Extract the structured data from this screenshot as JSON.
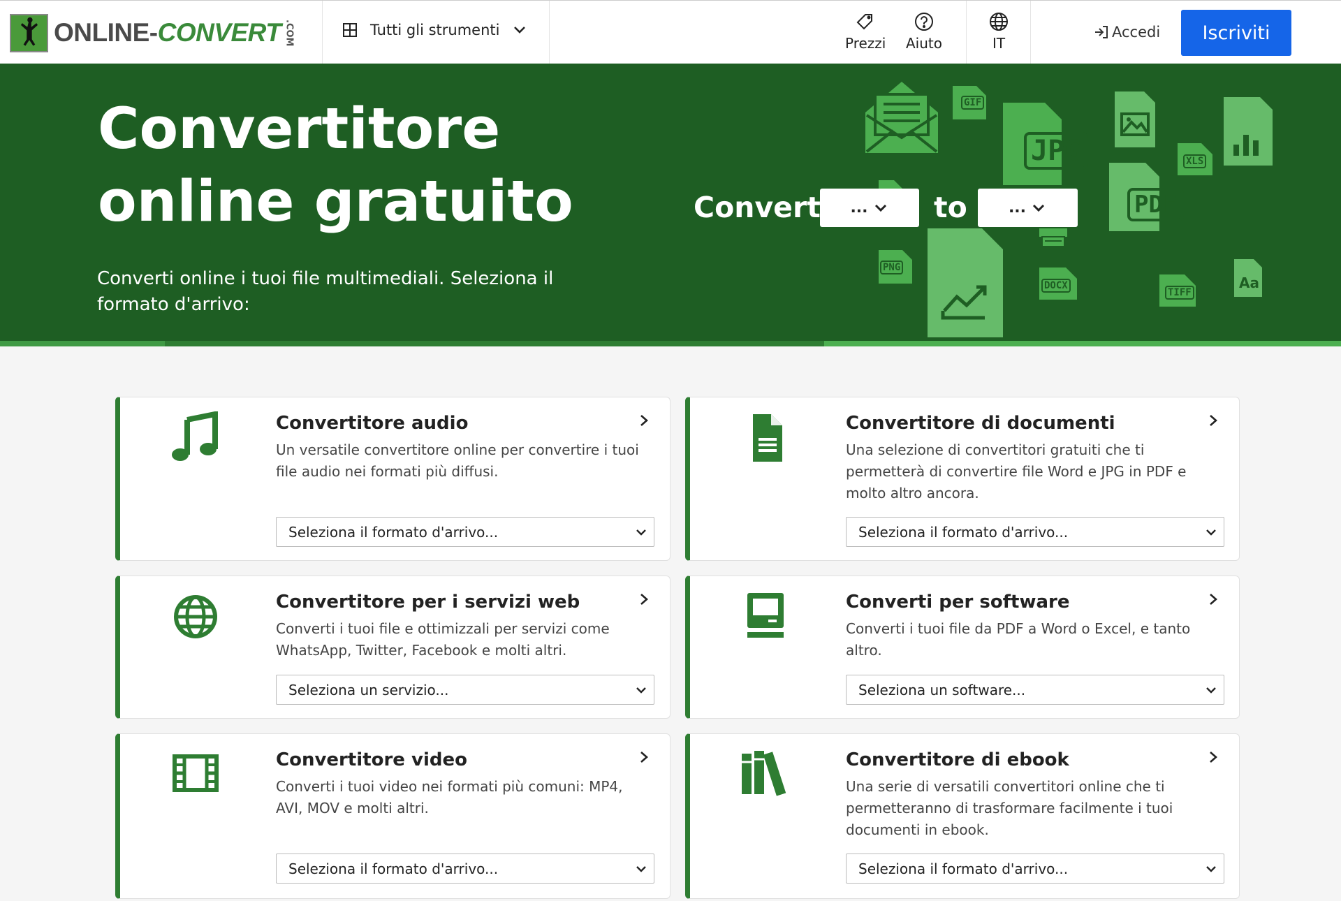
{
  "header": {
    "logo_text_1": "ONLINE-",
    "logo_text_2": "CONVERT",
    "logo_com": ".COM",
    "tools_label": "Tutti gli strumenti",
    "prices_label": "Prezzi",
    "help_label": "Aiuto",
    "language_label": "IT",
    "login_label": "Accedi",
    "signup_label": "Iscriviti"
  },
  "hero": {
    "title_line1": "Convertitore",
    "title_line2": "online gratuito",
    "subtitle": "Converti online i tuoi file multimediali. Seleziona il formato d'arrivo:",
    "convert_label": "Convert",
    "to_label": "to",
    "from_select_value": "...",
    "to_select_value": "...",
    "file_badges": [
      "GIF",
      "JPG",
      "XLS",
      "PDF",
      "PNG",
      "DOCX",
      "TIFF",
      "Aa"
    ]
  },
  "cards": [
    {
      "title": "Convertitore audio",
      "description": "Un versatile convertitore online per convertire i tuoi file audio nei formati più diffusi.",
      "select": "Seleziona il formato d'arrivo...",
      "icon": "music-note-icon"
    },
    {
      "title": "Convertitore di documenti",
      "description": "Una selezione di convertitori gratuiti che ti permetterà di convertire file Word e JPG in PDF e molto altro ancora.",
      "select": "Seleziona il formato d'arrivo...",
      "icon": "document-icon"
    },
    {
      "title": "Convertitore per i servizi web",
      "description": "Converti i tuoi file e ottimizzali per servizi come WhatsApp, Twitter, Facebook e molti altri.",
      "select": "Seleziona un servizio...",
      "icon": "globe-icon"
    },
    {
      "title": "Converti per software",
      "description": "Converti i tuoi file da PDF a Word o Excel, e tanto altro.",
      "select": "Seleziona un software...",
      "icon": "computer-icon"
    },
    {
      "title": "Convertitore video",
      "description": "Converti i tuoi video nei formati più comuni: MP4, AVI, MOV e molti altri.",
      "select": "Seleziona il formato d'arrivo...",
      "icon": "film-icon"
    },
    {
      "title": "Convertitore di ebook",
      "description": "Una serie di versatili convertitori online che ti permetteranno di trasformare facilmente i tuoi documenti in ebook.",
      "select": "Seleziona il formato d'arrivo...",
      "icon": "books-icon"
    }
  ],
  "colors": {
    "brand_green": "#1e5e23",
    "accent_green": "#4caf50",
    "button_blue": "#1565e8"
  }
}
